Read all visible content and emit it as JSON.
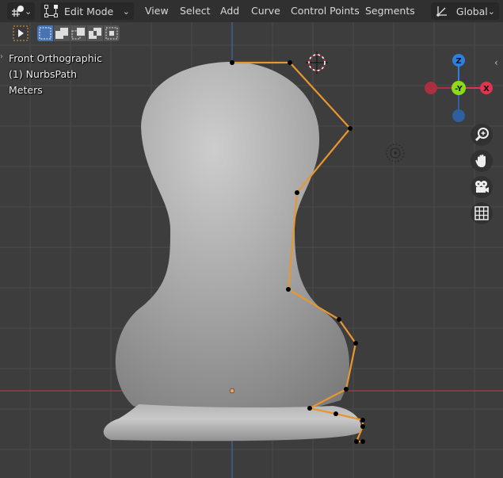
{
  "header": {
    "editor_type_icon": "object-axes-icon",
    "mode_selector": {
      "label": "Edit Mode",
      "icon": "curve-edit-icon"
    },
    "menus": [
      "View",
      "Select",
      "Add",
      "Curve",
      "Control Points",
      "Segments"
    ],
    "transform_orientation": {
      "label": "Global",
      "icon": "orientation-axes-icon"
    }
  },
  "toolbar": {
    "active_tool_icon": "select-cursor-icon",
    "selection_modes": [
      {
        "name": "set-new-selection",
        "active": true
      },
      {
        "name": "extend-selection",
        "active": false
      },
      {
        "name": "subtract-selection",
        "active": false
      },
      {
        "name": "invert-selection",
        "active": false
      },
      {
        "name": "intersect-selection",
        "active": false
      }
    ]
  },
  "overlay": {
    "view_name": "Front Orthographic",
    "object_name": "(1) NurbsPath",
    "units": "Meters"
  },
  "gizmo": {
    "axes": [
      {
        "label": "Z",
        "color": "#2f7fe0",
        "positive": true
      },
      {
        "label": "",
        "color": "#2f5f9e",
        "positive": false
      },
      {
        "label": "X",
        "color": "#e0344f",
        "positive": true
      },
      {
        "label": "",
        "color": "#a8303f",
        "positive": false
      },
      {
        "label": "-Y",
        "color": "#8bdc16",
        "positive": false
      }
    ]
  },
  "nav_buttons": [
    {
      "name": "zoom",
      "icon": "zoom-icon"
    },
    {
      "name": "pan",
      "icon": "hand-icon"
    },
    {
      "name": "camera-view",
      "icon": "camera-icon"
    },
    {
      "name": "toggle-ortho",
      "icon": "grid-icon"
    }
  ],
  "colors": {
    "viewport_bg": "#3d3d3d",
    "grid_line": "#4a4a4a",
    "x_axis_line": "#a0404e",
    "z_axis_line": "#3c6aa0",
    "curve_edge": "#e8962e",
    "control_point": "#000000",
    "object_origin": "#f5a05a",
    "mesh": "#b8b8b8"
  }
}
